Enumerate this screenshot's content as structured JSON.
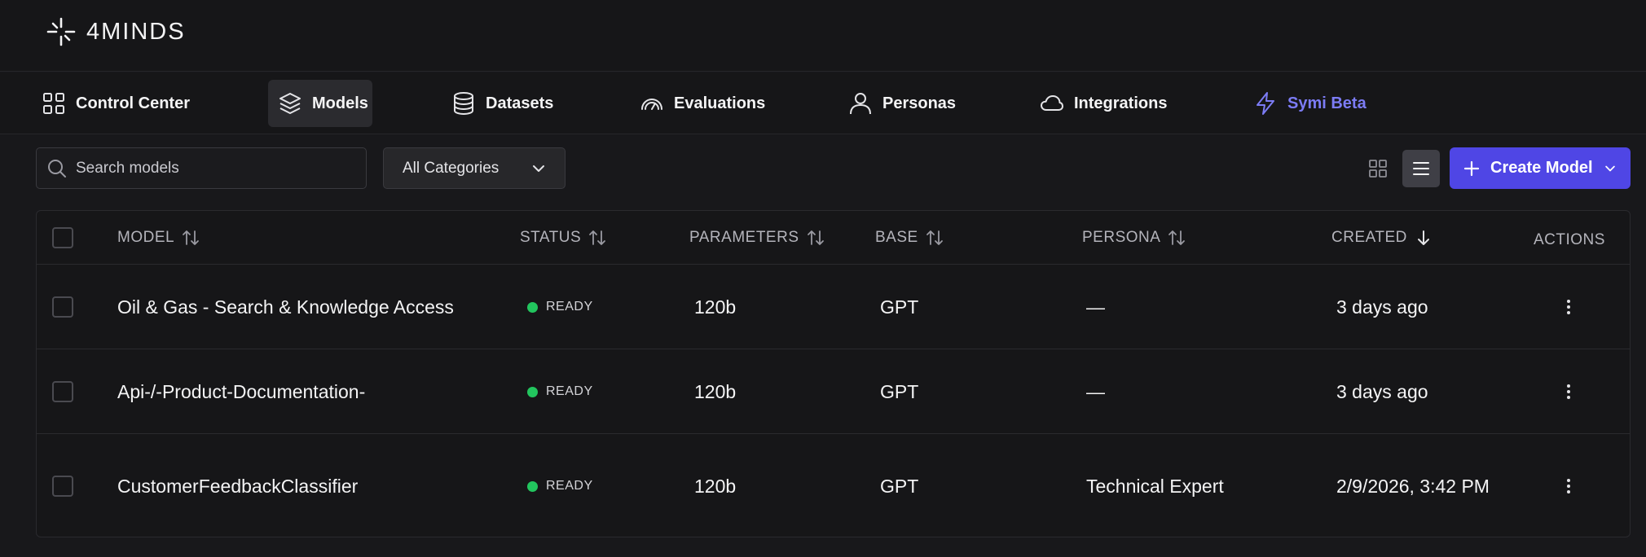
{
  "brand": {
    "name": "4MINDS"
  },
  "nav": {
    "items": [
      {
        "label": "Control Center",
        "icon": "grid-icon"
      },
      {
        "label": "Models",
        "icon": "layers-icon"
      },
      {
        "label": "Datasets",
        "icon": "database-icon"
      },
      {
        "label": "Evaluations",
        "icon": "gauge-icon"
      },
      {
        "label": "Personas",
        "icon": "user-icon"
      },
      {
        "label": "Integrations",
        "icon": "cloud-icon"
      },
      {
        "label": "Symi Beta",
        "icon": "lightning-icon"
      }
    ],
    "active": "Models"
  },
  "toolbar": {
    "search_placeholder": "Search models",
    "category_selected": "All Categories",
    "create_label": "Create Model"
  },
  "table": {
    "headers": {
      "model": "MODEL",
      "status": "STATUS",
      "parameters": "PARAMETERS",
      "base": "BASE",
      "persona": "PERSONA",
      "created": "CREATED",
      "actions": "ACTIONS"
    },
    "rows": [
      {
        "model": "Oil & Gas - Search & Knowledge Access",
        "status": "READY",
        "parameters": "120b",
        "base": "GPT",
        "persona": "—",
        "created": "3 days ago"
      },
      {
        "model": "Api-/-Product-Documentation-",
        "status": "READY",
        "parameters": "120b",
        "base": "GPT",
        "persona": "—",
        "created": "3 days ago"
      },
      {
        "model": "CustomerFeedbackClassifier",
        "status": "READY",
        "parameters": "120b",
        "base": "GPT",
        "persona": "Technical Expert",
        "created": "2/9/2026, 3:42 PM"
      }
    ]
  },
  "colors": {
    "background": "#18181b",
    "accent": "#4f46e5",
    "beta": "#7c7cf5",
    "ready": "#22c55e"
  }
}
